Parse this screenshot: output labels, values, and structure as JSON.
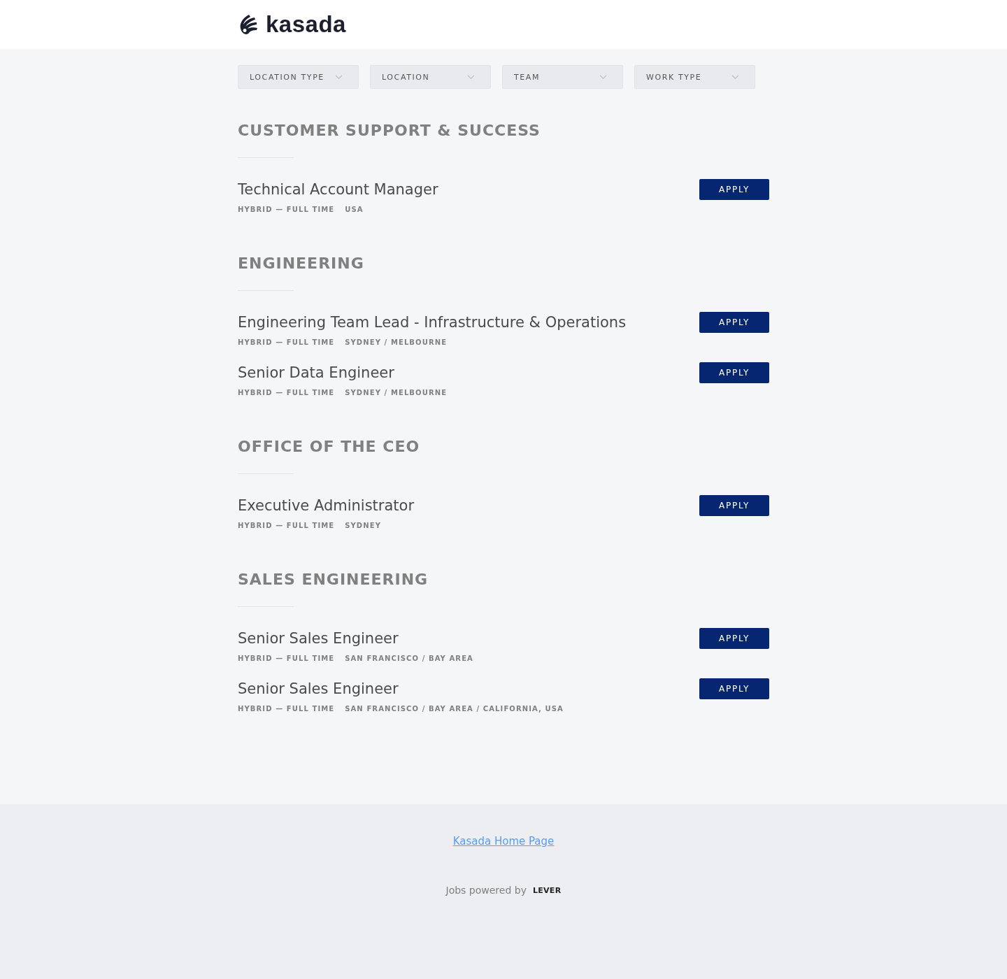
{
  "header": {
    "logo": "kasada"
  },
  "filters": [
    {
      "label": "LOCATION TYPE"
    },
    {
      "label": "LOCATION"
    },
    {
      "label": "TEAM"
    },
    {
      "label": "WORK TYPE"
    }
  ],
  "sections": [
    {
      "title": "CUSTOMER SUPPORT & SUCCESS",
      "postings": [
        {
          "title": "Technical Account Manager",
          "commitment": "HYBRID — FULL TIME",
          "location": "USA",
          "button": "APPLY"
        }
      ]
    },
    {
      "title": "ENGINEERING",
      "postings": [
        {
          "title": "Engineering Team Lead - Infrastructure & Operations",
          "commitment": "HYBRID — FULL TIME",
          "location": "SYDNEY / MELBOURNE",
          "button": "APPLY"
        },
        {
          "title": "Senior Data Engineer",
          "commitment": "HYBRID — FULL TIME",
          "location": "SYDNEY / MELBOURNE",
          "button": "APPLY"
        }
      ]
    },
    {
      "title": "OFFICE OF THE CEO",
      "postings": [
        {
          "title": "Executive Administrator",
          "commitment": "HYBRID — FULL TIME",
          "location": "SYDNEY",
          "button": "APPLY"
        }
      ]
    },
    {
      "title": "SALES ENGINEERING",
      "postings": [
        {
          "title": "Senior Sales Engineer",
          "commitment": "HYBRID — FULL TIME",
          "location": "SAN FRANCISCO / BAY AREA",
          "button": "APPLY"
        },
        {
          "title": "Senior Sales Engineer",
          "commitment": "HYBRID — FULL TIME",
          "location": "SAN FRANCISCO / BAY AREA / CALIFORNIA, USA",
          "button": "APPLY"
        }
      ]
    }
  ],
  "footer": {
    "link": "Kasada Home Page",
    "powered_by": "Jobs powered by",
    "brand": "LEVER"
  }
}
